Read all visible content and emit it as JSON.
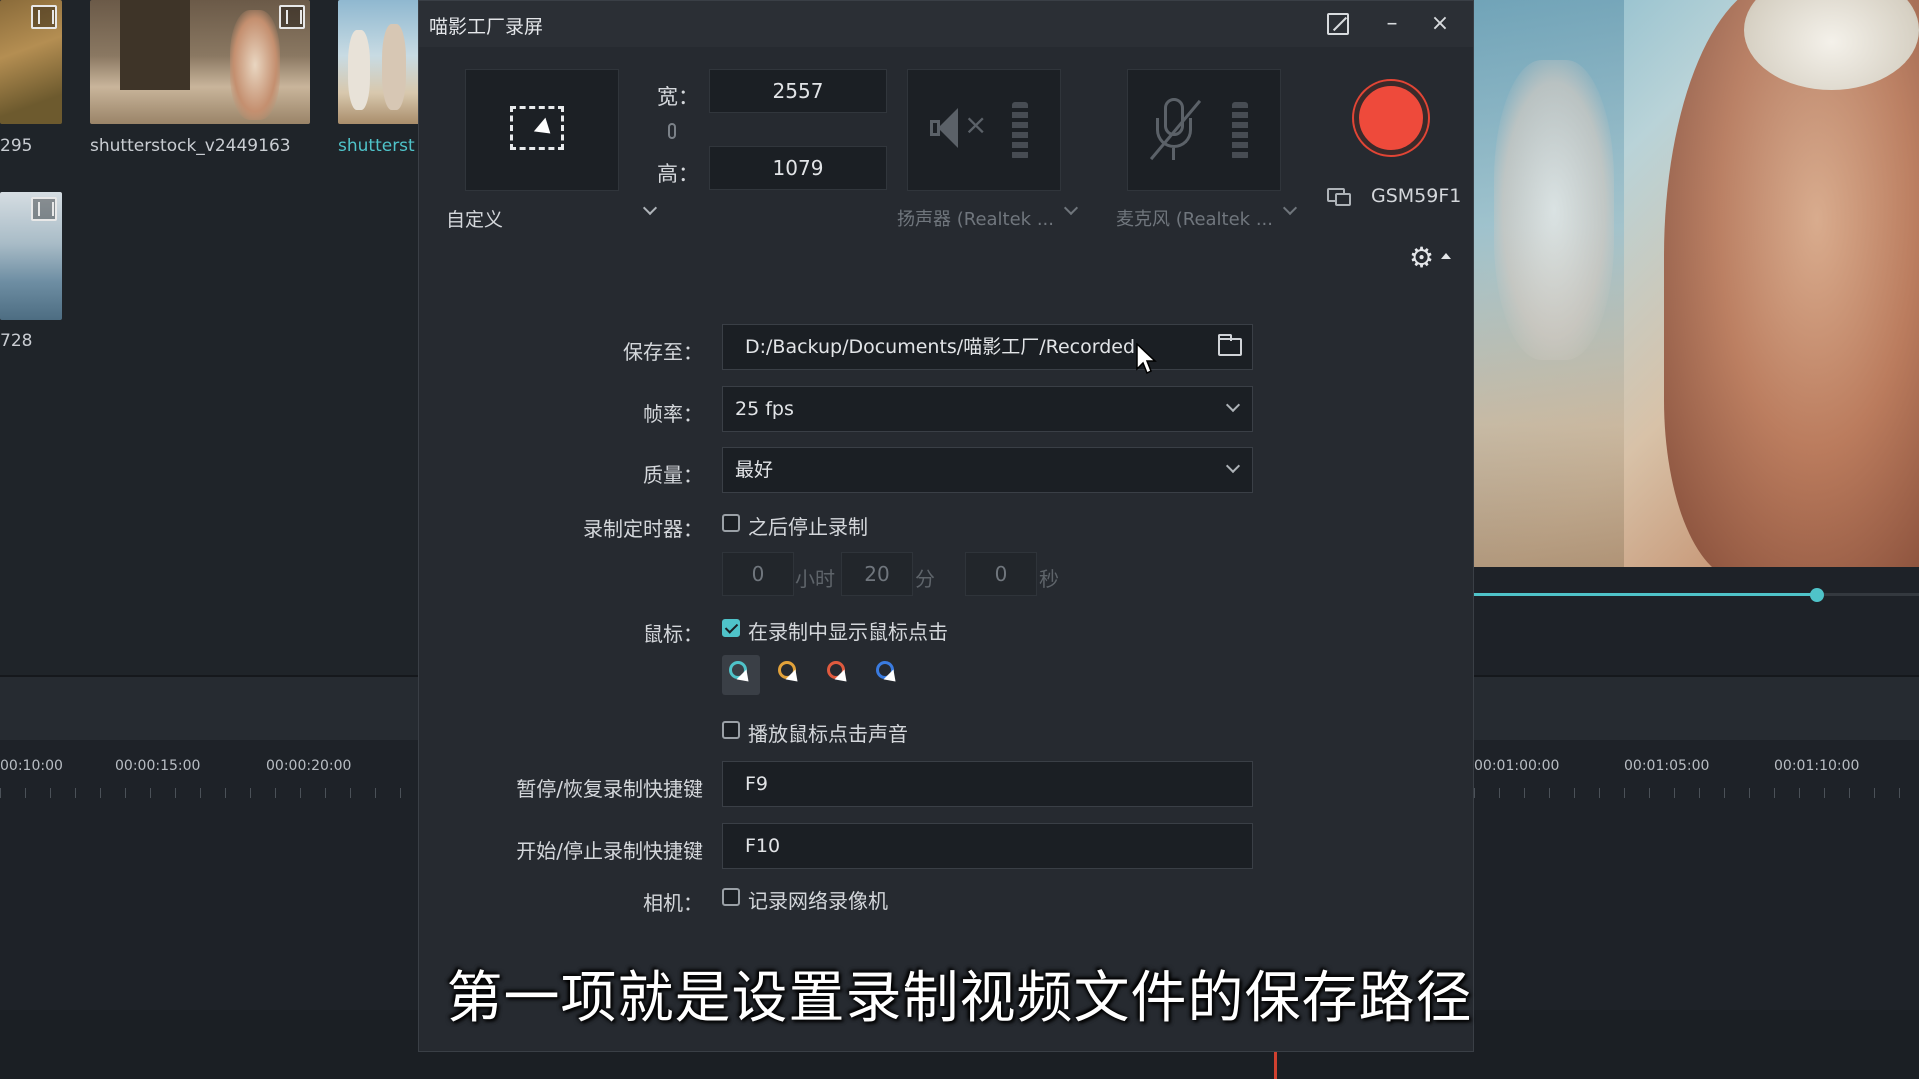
{
  "media": {
    "thumb_labels": [
      "295",
      "shutterstock_v2449163",
      "shutterst",
      "728"
    ]
  },
  "timeline": {
    "left_ticks": [
      "00:10:00",
      "00:00:15:00",
      "00:00:20:00"
    ],
    "right_ticks": [
      "00:01:00:00",
      "00:01:05:00",
      "00:01:10:00"
    ]
  },
  "preview": {
    "progress": 0.77
  },
  "recorder": {
    "title": "喵影工厂录屏",
    "window_buttons": {
      "minimize": "–",
      "close": "×"
    },
    "region": {
      "mode_label": "自定义",
      "width_label": "宽：",
      "width_value": "2557",
      "height_label": "高：",
      "height_value": "1079"
    },
    "audio": {
      "speaker_label": "扬声器 (Realtek ...",
      "mic_label": "麦克风 (Realtek ..."
    },
    "monitor_name": "GSM59F1",
    "settings": {
      "save_to_label": "保存至：",
      "save_path": "D:/Backup/Documents/喵影工厂/Recorded",
      "fps_label": "帧率：",
      "fps_value": "25 fps",
      "quality_label": "质量：",
      "quality_value": "最好",
      "timer_label": "录制定时器：",
      "timer_check_label": "之后停止录制",
      "timer_hours": "0",
      "timer_hours_unit": "小时",
      "timer_minutes": "20",
      "timer_minutes_unit": "分",
      "timer_seconds": "0",
      "timer_seconds_unit": "秒",
      "mouse_label": "鼠标：",
      "show_clicks_label": "在录制中显示鼠标点击",
      "click_sound_label": "播放鼠标点击声音",
      "cursor_colors": [
        "#4fc3c9",
        "#e2a23a",
        "#e05a3e",
        "#3a7be0"
      ],
      "pause_hotkey_label": "暂停/恢复录制快捷键",
      "pause_hotkey_value": "F9",
      "start_hotkey_label": "开始/停止录制快捷键",
      "start_hotkey_value": "F10",
      "camera_label": "相机：",
      "camera_check_label": "记录网络录像机"
    },
    "colors": {
      "record": "#ee4a3b",
      "accent": "#4fc3c9"
    }
  },
  "subtitle": "第一项就是设置录制视频文件的保存路径"
}
